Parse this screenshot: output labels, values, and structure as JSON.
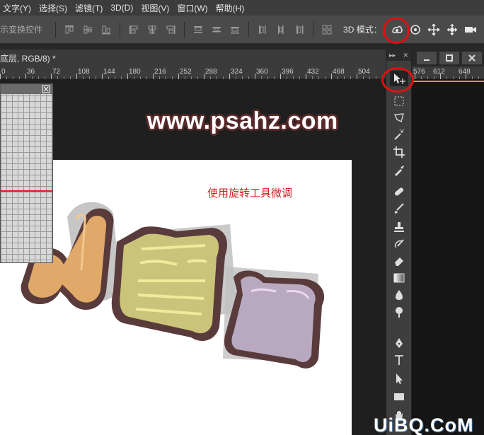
{
  "menu": [
    "文字(Y)",
    "选择(S)",
    "滤镜(T)",
    "3D(D)",
    "视图(V)",
    "窗口(W)",
    "帮助(H)"
  ],
  "options": {
    "transform_controls_label": "示变换控件",
    "mode_label": "3D 模式："
  },
  "document": {
    "tab_title": "底层, RGB/8) *"
  },
  "ruler": {
    "ticks": [
      "0",
      "36",
      "72",
      "108",
      "144",
      "180",
      "216",
      "252",
      "288",
      "324",
      "360",
      "396",
      "432",
      "468",
      "504"
    ],
    "right_ticks": [
      "576",
      "612",
      "648"
    ]
  },
  "canvas": {
    "watermark": "www.psahz.com",
    "caption": "使用旋转工具微调"
  },
  "toolbox": {
    "collapse": "▸▸",
    "close": "✕"
  },
  "footer_logo": "UiBQ.CoM",
  "colors": {
    "highlight": "#e01010",
    "caption": "#d12020",
    "accent_outline": "#c8a050"
  }
}
